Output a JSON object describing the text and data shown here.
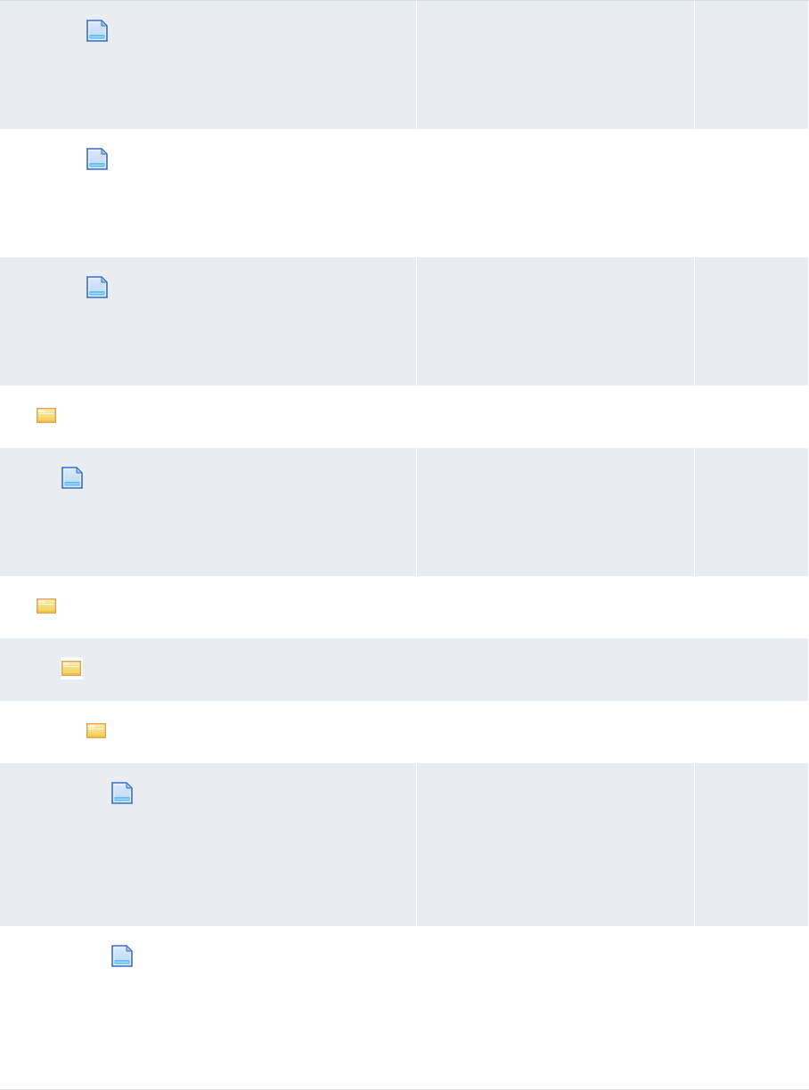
{
  "tree": {
    "rows": [
      {
        "children": [
          {
            "children": [
              {
                "kind": "file"
              },
              {
                "kind": "file"
              },
              {
                "kind": "file"
              }
            ]
          }
        ]
      },
      {
        "kind": "folder",
        "children": [
          {
            "kind": "file"
          }
        ]
      },
      {
        "kind": "folder",
        "children": [
          {
            "kind": "folder",
            "children": [
              {
                "kind": "folder",
                "children": [
                  {
                    "kind": "file"
                  },
                  {
                    "kind": "file"
                  }
                ]
              }
            ]
          }
        ]
      }
    ]
  }
}
